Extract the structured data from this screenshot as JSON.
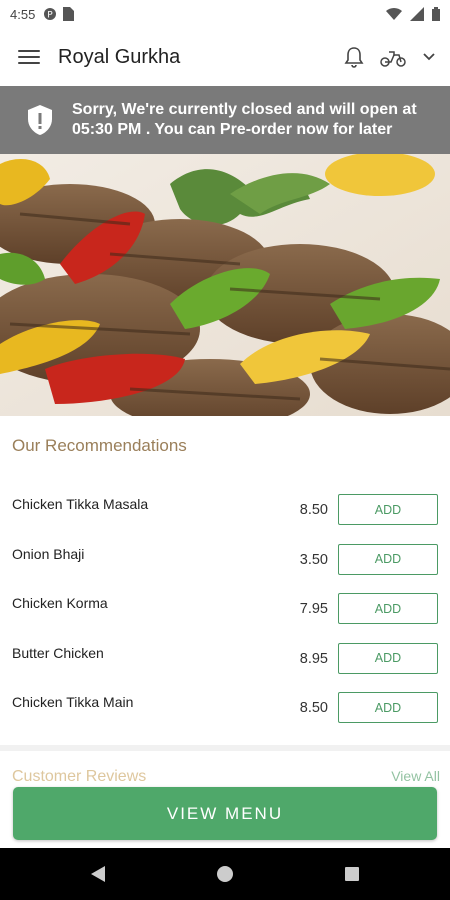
{
  "status": {
    "time": "4:55"
  },
  "app": {
    "title": "Royal Gurkha"
  },
  "banner": {
    "line1": "Sorry, We're currently closed and will open at",
    "line2": "05:30 PM . You can Pre-order now for later"
  },
  "recommendations": {
    "title": "Our Recommendations",
    "add_label": "ADD",
    "items": [
      {
        "name": "Chicken Tikka Masala",
        "price": "8.50"
      },
      {
        "name": "Onion Bhaji",
        "price": "3.50"
      },
      {
        "name": "Chicken Korma",
        "price": "7.95"
      },
      {
        "name": "Butter Chicken",
        "price": "8.95"
      },
      {
        "name": "Chicken Tikka Main",
        "price": "8.50"
      }
    ]
  },
  "peek": {
    "left": "Customer Reviews",
    "right": "View All"
  },
  "cta": {
    "label": "VIEW MENU"
  },
  "icons": {
    "menu": "hamburger-icon",
    "bell": "bell-icon",
    "delivery": "scooter-icon",
    "chevron": "chevron-down-icon",
    "shield": "shield-alert-icon"
  },
  "colors": {
    "accent": "#4fa86a",
    "banner": "#7a7a7a",
    "section_title": "#9a7f5a"
  }
}
